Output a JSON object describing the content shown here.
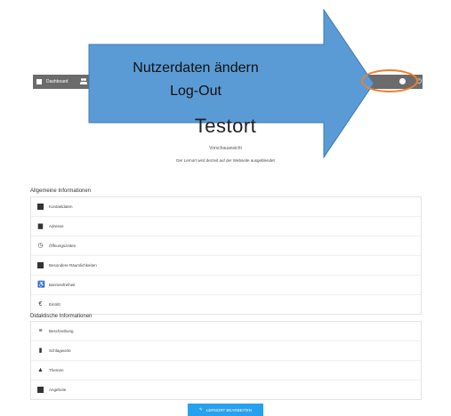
{
  "navbar": {
    "dashboard_label": "Dashboard",
    "icons": [
      "dashboard-icon",
      "users-icon",
      "user-circle-icon",
      "power-icon"
    ]
  },
  "annotation": {
    "line1": "Nutzerdaten ändern",
    "line2": "Log-Out",
    "arrow_color": "#5b9bd5",
    "circle_color": "#f07f2a"
  },
  "page": {
    "title": "Testort",
    "preview": "Vorschauansicht",
    "notice": "Der Lernort wird derzeit auf der Webseite ausgeblendet"
  },
  "general": {
    "heading": "Allgemeine Informationen",
    "items": [
      {
        "label": "Kontaktdaten",
        "icon": "contact-card-icon"
      },
      {
        "label": "Adresse",
        "icon": "building-icon"
      },
      {
        "label": "Öffnungszeiten",
        "icon": "clock-icon"
      },
      {
        "label": "Besondere Räumlichkeiten",
        "icon": "rooms-icon"
      },
      {
        "label": "Barrierefreiheit",
        "icon": "wheelchair-icon"
      },
      {
        "label": "Eintritt",
        "icon": "euro-icon"
      }
    ]
  },
  "didactic": {
    "heading": "Didaktische Informationen",
    "items": [
      {
        "label": "Beschreibung",
        "icon": "text-lines-icon"
      },
      {
        "label": "Schlagworte",
        "icon": "bookmark-icon"
      },
      {
        "label": "Themen",
        "icon": "graduation-cap-icon"
      },
      {
        "label": "Angebote",
        "icon": "offer-icon"
      }
    ]
  },
  "edit_button": {
    "label": "LERNORT BEARBEITEN",
    "color": "#28a0f0"
  }
}
